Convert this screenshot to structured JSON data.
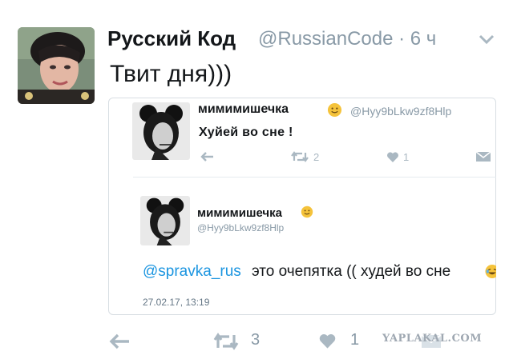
{
  "tweet": {
    "author_name": "Русский Код",
    "author_handle": "@RussianCode · 6 ч",
    "text": "Твит дня)))",
    "actions": {
      "retweets": "3",
      "likes": "1"
    }
  },
  "quoted_screenshots": {
    "first": {
      "name": "мимимишечка",
      "handle": "@Hyy9bLkw9zf8Hlp",
      "text": "Хуйей во сне !",
      "retweets": "2",
      "likes": "1"
    },
    "second": {
      "name": "мимимишечка",
      "handle": "@Hyy9bLkw9zf8Hlp",
      "mention": "@spravka_rus",
      "text": "это очепятка (( худей во сне",
      "date": "27.02.17, 13:19"
    }
  },
  "watermark": "YAPLAKAL.COM",
  "colors": {
    "text": "#14171a",
    "muted": "#8899a6",
    "link": "#1b95e0",
    "border": "#d8dee3"
  },
  "icons": [
    "chevron-down-icon",
    "reply-icon",
    "retweet-icon",
    "heart-icon",
    "envelope-icon",
    "slightly-smiling-emoji",
    "laughing-emoji"
  ]
}
